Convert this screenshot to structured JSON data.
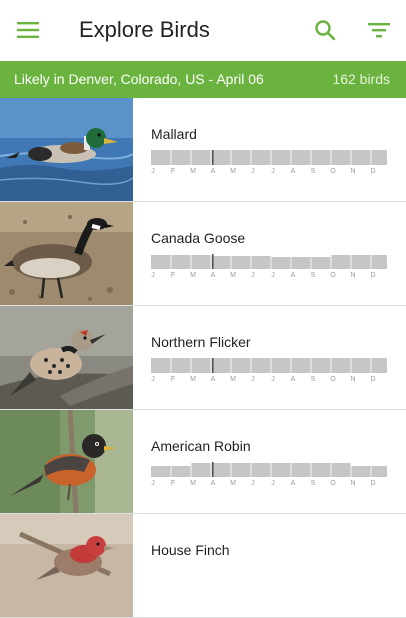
{
  "app": {
    "title": "Explore Birds"
  },
  "icons": {
    "menu": "menu-icon",
    "search": "search-icon",
    "filter": "filter-icon"
  },
  "colors": {
    "accent": "#6ab33e",
    "histogram": "#c6c6c6"
  },
  "banner": {
    "text": "Likely in Denver, Colorado, US - April 06",
    "count": "162 birds"
  },
  "months": [
    "J",
    "F",
    "M",
    "A",
    "M",
    "J",
    "J",
    "A",
    "S",
    "O",
    "N",
    "D"
  ],
  "birds": [
    {
      "name": "Mallard"
    },
    {
      "name": "Canada Goose"
    },
    {
      "name": "Northern Flicker"
    },
    {
      "name": "American Robin"
    },
    {
      "name": "House Finch"
    }
  ]
}
